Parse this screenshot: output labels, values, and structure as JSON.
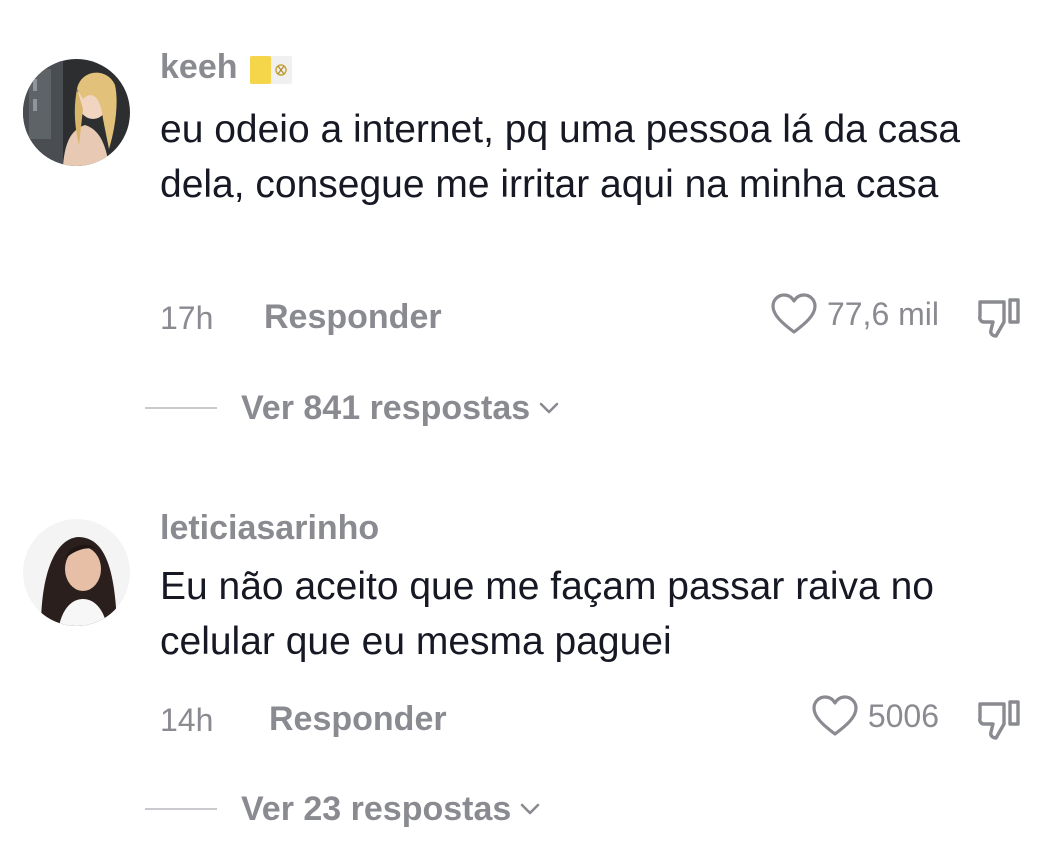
{
  "comments": [
    {
      "username": "keeh",
      "flag_icon": "vatican-flag-icon",
      "text": "eu odeio a internet, pq uma pessoa lá da casa dela, consegue me irritar aqui na minha casa",
      "time": "17h",
      "reply_label": "Responder",
      "likes": "77,6 mil",
      "view_replies": "Ver 841 respostas"
    },
    {
      "username": "leticiasarinho",
      "text": "Eu não aceito que me façam passar raiva no celular que eu mesma paguei",
      "time": "14h",
      "reply_label": "Responder",
      "likes": "5006",
      "view_replies": "Ver 23 respostas"
    }
  ],
  "icons": {
    "like": "heart-outline-icon",
    "dislike": "thumbs-down-icon",
    "expand": "chevron-down-icon"
  },
  "colors": {
    "primary_text": "#161823",
    "secondary_text": "#8a8b91",
    "divider": "#c9cacd"
  }
}
